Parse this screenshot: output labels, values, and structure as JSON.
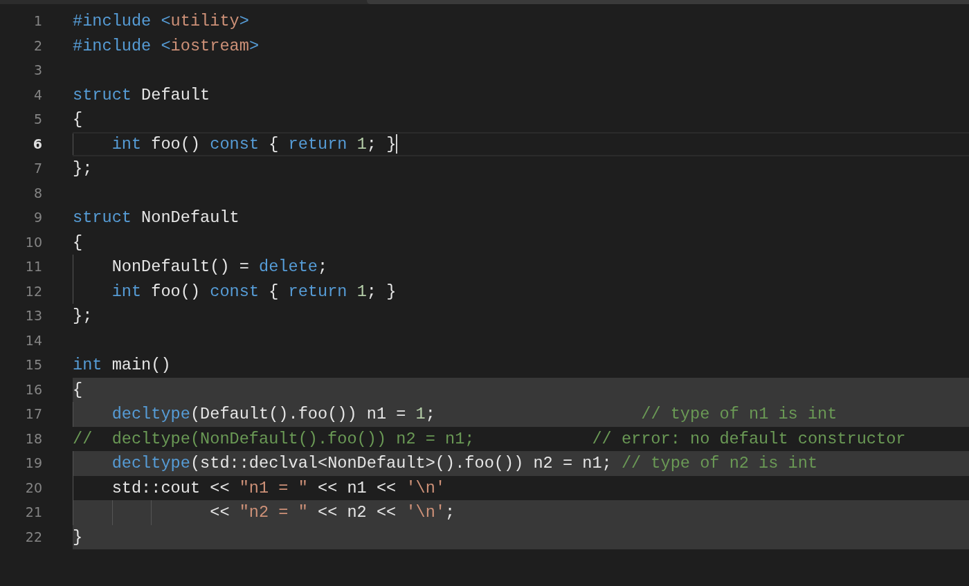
{
  "editor": {
    "lines": [
      {
        "number": "1",
        "selected": false,
        "current": false,
        "tokens": [
          {
            "kind": "keyword",
            "s": "#include <"
          },
          {
            "kind": "string",
            "s": "utility"
          },
          {
            "kind": "keyword",
            "s": ">"
          }
        ]
      },
      {
        "number": "2",
        "selected": false,
        "current": false,
        "tokens": [
          {
            "kind": "keyword",
            "s": "#include <"
          },
          {
            "kind": "string",
            "s": "iostream"
          },
          {
            "kind": "keyword",
            "s": ">"
          }
        ]
      },
      {
        "number": "3",
        "selected": false,
        "current": false
      },
      {
        "number": "4",
        "selected": false,
        "current": false,
        "tokens": [
          {
            "kind": "keyword",
            "s": "struct"
          },
          {
            "kind": "plain",
            "s": " Default"
          }
        ]
      },
      {
        "number": "5",
        "selected": false,
        "current": false,
        "tokens": [
          {
            "kind": "plain",
            "s": "{"
          }
        ]
      },
      {
        "number": "6",
        "selected": false,
        "current": true,
        "tokens": [
          {
            "kind": "keyword",
            "s": "    int"
          },
          {
            "kind": "plain",
            "s": " foo() "
          },
          {
            "kind": "keyword",
            "s": "const"
          },
          {
            "kind": "plain",
            "s": " { "
          },
          {
            "kind": "keyword",
            "s": "return"
          },
          {
            "kind": "number",
            "s": " 1"
          },
          {
            "kind": "plain",
            "s": "; }"
          }
        ]
      },
      {
        "number": "7",
        "selected": false,
        "current": false,
        "tokens": [
          {
            "kind": "plain",
            "s": "};"
          }
        ]
      },
      {
        "number": "8",
        "selected": false,
        "current": false
      },
      {
        "number": "9",
        "selected": false,
        "current": false,
        "tokens": [
          {
            "kind": "keyword",
            "s": "struct"
          },
          {
            "kind": "plain",
            "s": " NonDefault"
          }
        ]
      },
      {
        "number": "10",
        "selected": false,
        "current": false,
        "tokens": [
          {
            "kind": "plain",
            "s": "{"
          }
        ]
      },
      {
        "number": "11",
        "selected": false,
        "current": false,
        "tokens": [
          {
            "kind": "plain",
            "s": "    NonDefault() = "
          },
          {
            "kind": "keyword",
            "s": "delete"
          },
          {
            "kind": "plain",
            "s": ";"
          }
        ]
      },
      {
        "number": "12",
        "selected": false,
        "current": false,
        "tokens": [
          {
            "kind": "keyword",
            "s": "    int"
          },
          {
            "kind": "plain",
            "s": " foo() "
          },
          {
            "kind": "keyword",
            "s": "const"
          },
          {
            "kind": "plain",
            "s": " { "
          },
          {
            "kind": "keyword",
            "s": "return"
          },
          {
            "kind": "number",
            "s": " 1"
          },
          {
            "kind": "plain",
            "s": "; }"
          }
        ]
      },
      {
        "number": "13",
        "selected": false,
        "current": false,
        "tokens": [
          {
            "kind": "plain",
            "s": "};"
          }
        ]
      },
      {
        "number": "14",
        "selected": false,
        "current": false
      },
      {
        "number": "15",
        "selected": false,
        "current": false,
        "tokens": [
          {
            "kind": "keyword",
            "s": "int"
          },
          {
            "kind": "plain",
            "s": " main()"
          }
        ]
      },
      {
        "number": "16",
        "selected": true,
        "current": false,
        "tokens": [
          {
            "kind": "plain",
            "s": "{"
          }
        ]
      },
      {
        "number": "17",
        "selected": true,
        "current": false,
        "tokens": [
          {
            "kind": "keyword",
            "s": "    decltype"
          },
          {
            "kind": "plain",
            "s": "(Default().foo()) n1 = "
          },
          {
            "kind": "number",
            "s": "1"
          },
          {
            "kind": "plain",
            "s": ";"
          },
          {
            "kind": "comment",
            "s": "                     // type of n1 is int"
          }
        ]
      },
      {
        "number": "18",
        "selected": false,
        "current": false,
        "tokens": [
          {
            "kind": "comment",
            "s": "//  decltype(NonDefault().foo()) n2 = n1;            // error: no default constructor"
          }
        ]
      },
      {
        "number": "19",
        "selected": true,
        "current": false,
        "tokens": [
          {
            "kind": "keyword",
            "s": "    decltype"
          },
          {
            "kind": "plain",
            "s": "(std::declval<NonDefault>().foo()) n2 = n1; "
          },
          {
            "kind": "comment",
            "s": "// type of n2 is int"
          }
        ]
      },
      {
        "number": "20",
        "selected": false,
        "current": false,
        "tokens": [
          {
            "kind": "plain",
            "s": "    std::cout << "
          },
          {
            "kind": "string",
            "s": "\"n1 = \""
          },
          {
            "kind": "plain",
            "s": " << n1 << "
          },
          {
            "kind": "string",
            "s": "'\\n'"
          }
        ]
      },
      {
        "number": "21",
        "selected": true,
        "current": false,
        "tokens": [
          {
            "kind": "plain",
            "s": "              << "
          },
          {
            "kind": "string",
            "s": "\"n2 = \""
          },
          {
            "kind": "plain",
            "s": " << n2 << "
          },
          {
            "kind": "string",
            "s": "'\\n'"
          },
          {
            "kind": "plain",
            "s": ";"
          }
        ]
      },
      {
        "number": "22",
        "selected": true,
        "current": false,
        "tokens": [
          {
            "kind": "plain",
            "s": "}"
          }
        ]
      }
    ]
  }
}
